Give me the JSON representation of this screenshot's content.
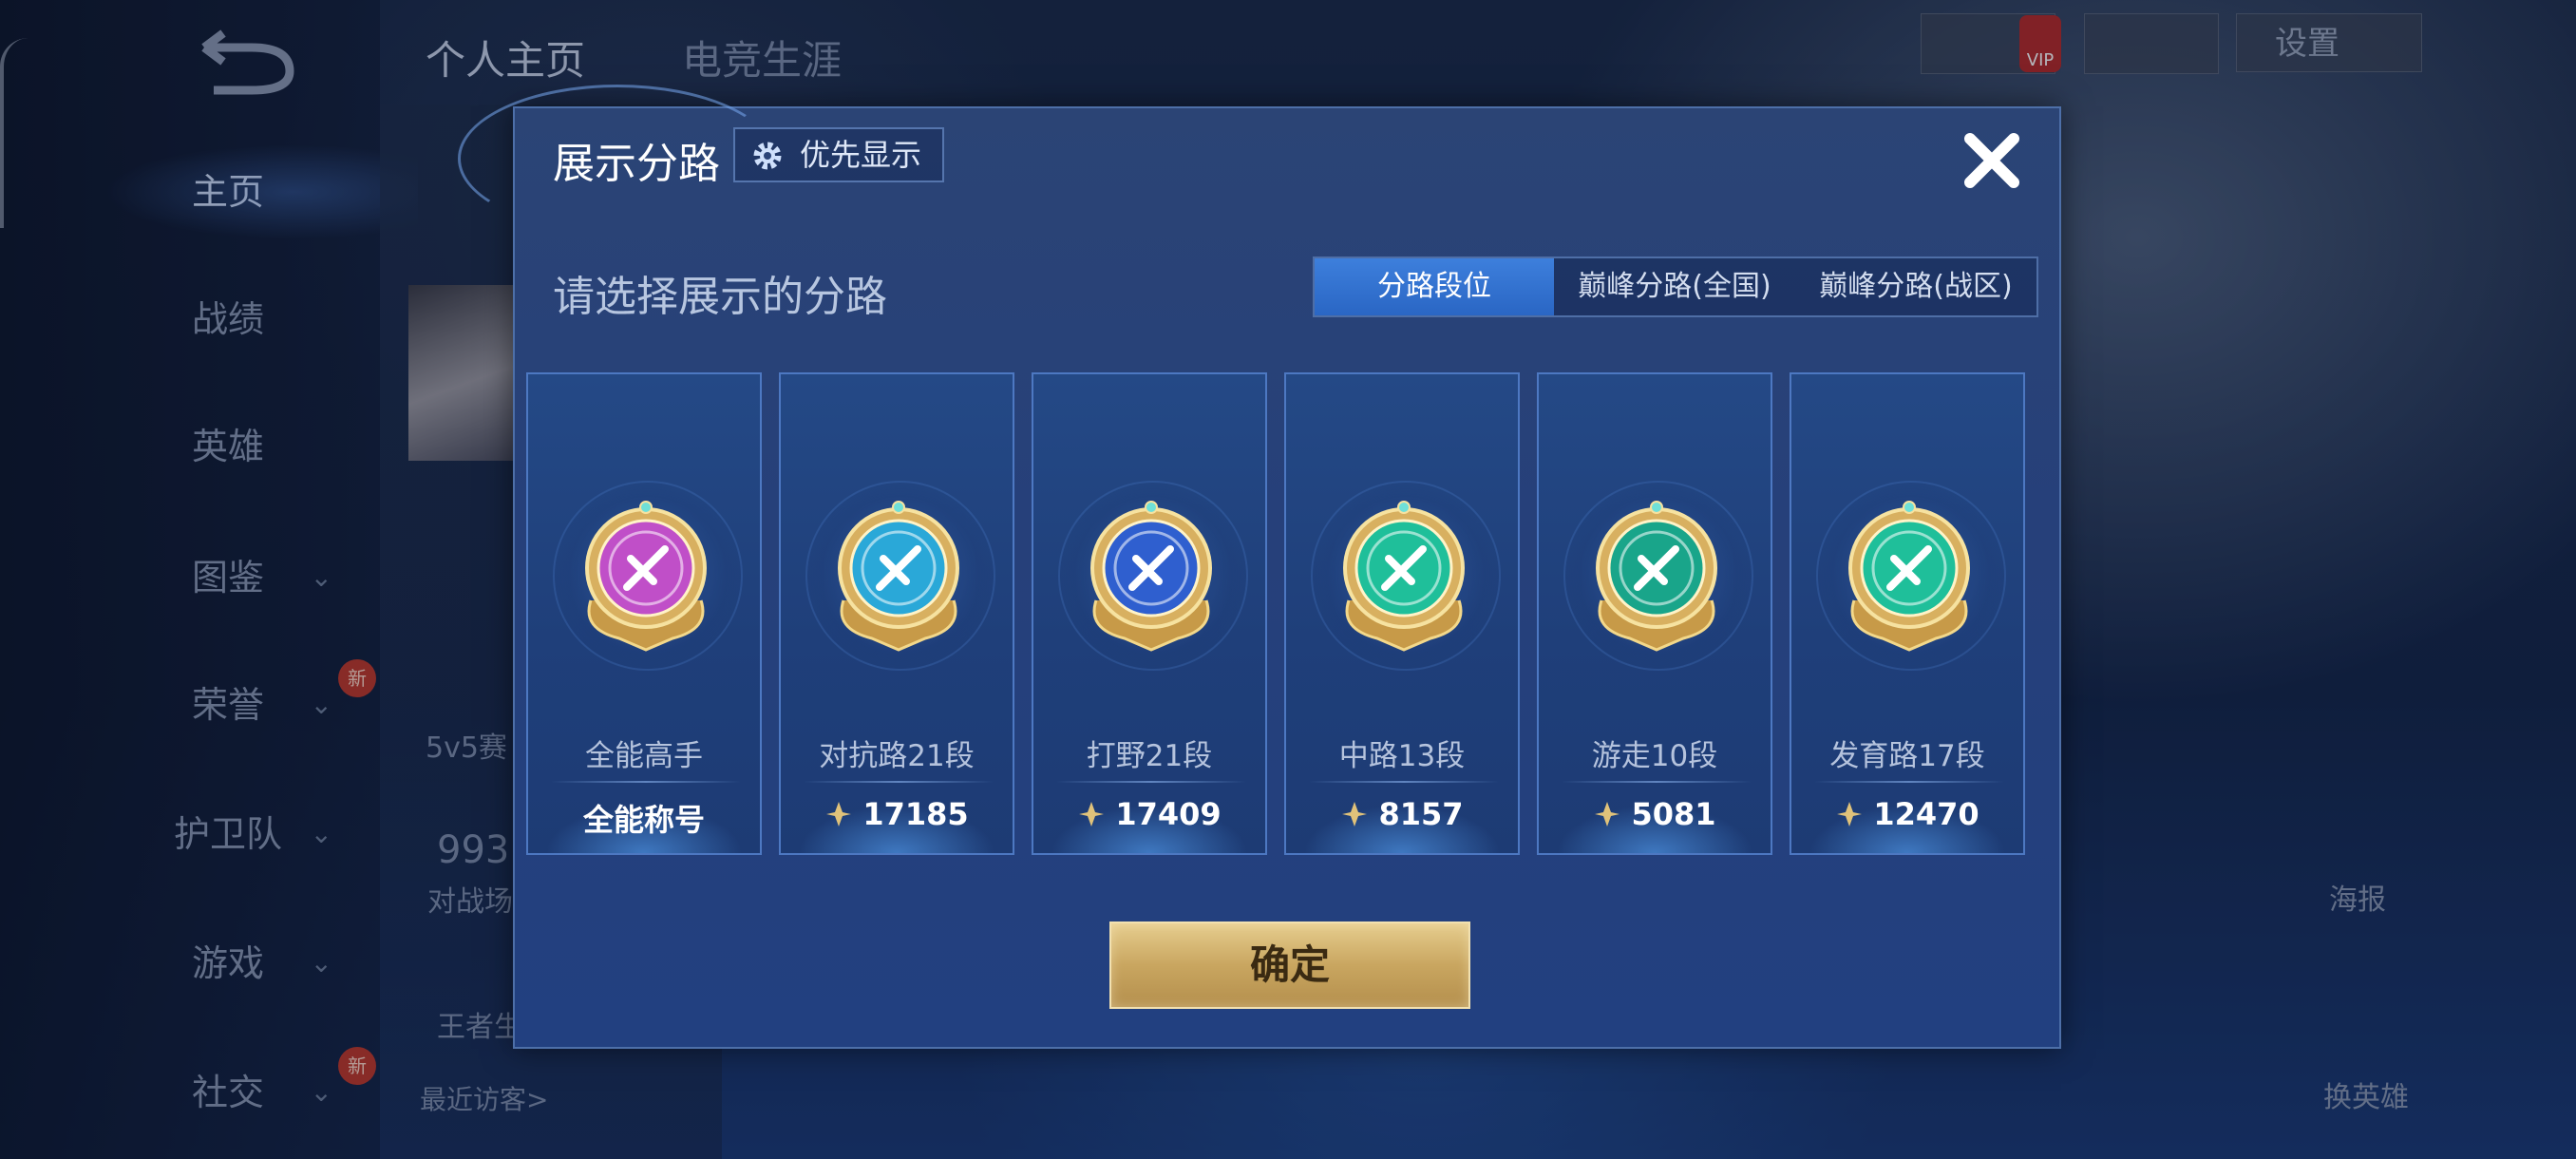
{
  "background": {
    "top_tabs": [
      "个人主页",
      "电竞生涯"
    ],
    "nav_items": [
      {
        "label": "主页",
        "active": true,
        "chevron": false,
        "new_badge": false
      },
      {
        "label": "战绩",
        "active": false,
        "chevron": false,
        "new_badge": false
      },
      {
        "label": "英雄",
        "active": false,
        "chevron": false,
        "new_badge": false
      },
      {
        "label": "图鉴",
        "active": false,
        "chevron": true,
        "new_badge": false
      },
      {
        "label": "荣誉",
        "active": false,
        "chevron": true,
        "new_badge": true
      },
      {
        "label": "护卫队",
        "active": false,
        "chevron": true,
        "new_badge": false
      },
      {
        "label": "游戏",
        "active": false,
        "chevron": true,
        "new_badge": false
      },
      {
        "label": "社交",
        "active": false,
        "chevron": true,
        "new_badge": true
      }
    ],
    "new_badge_text": "新",
    "profile_fragments": [
      "5v5赛",
      "993",
      "对战场",
      "王者生",
      "最近访客>"
    ],
    "top_right": {
      "settings_label": "设置",
      "vip_label": "VIP"
    },
    "right_buttons": [
      "海报",
      "换英雄"
    ]
  },
  "dialog": {
    "title": "展示分路",
    "priority_button": "优先显示",
    "subtitle": "请选择展示的分路",
    "tabs": [
      {
        "label": "分路段位",
        "active": true
      },
      {
        "label": "巅峰分路(全国)",
        "active": false
      },
      {
        "label": "巅峰分路(战区)",
        "active": false
      }
    ],
    "cards": [
      {
        "role": "全能高手",
        "value": "全能称号",
        "emblem": "all-round-emblem",
        "color": "#c04fc8",
        "show_points_icon": false
      },
      {
        "role": "对抗路21段",
        "value": "17185",
        "emblem": "clash-lane-emblem",
        "color": "#2aa8d8",
        "show_points_icon": true
      },
      {
        "role": "打野21段",
        "value": "17409",
        "emblem": "jungle-emblem",
        "color": "#2f5fcf",
        "show_points_icon": true
      },
      {
        "role": "中路13段",
        "value": "8157",
        "emblem": "mid-lane-emblem",
        "color": "#1fbf9a",
        "show_points_icon": true
      },
      {
        "role": "游走10段",
        "value": "5081",
        "emblem": "roam-emblem",
        "color": "#19a58a",
        "show_points_icon": true
      },
      {
        "role": "发育路17段",
        "value": "12470",
        "emblem": "farm-lane-emblem",
        "color": "#1fbf9a",
        "show_points_icon": true
      }
    ],
    "confirm_label": "确定"
  }
}
